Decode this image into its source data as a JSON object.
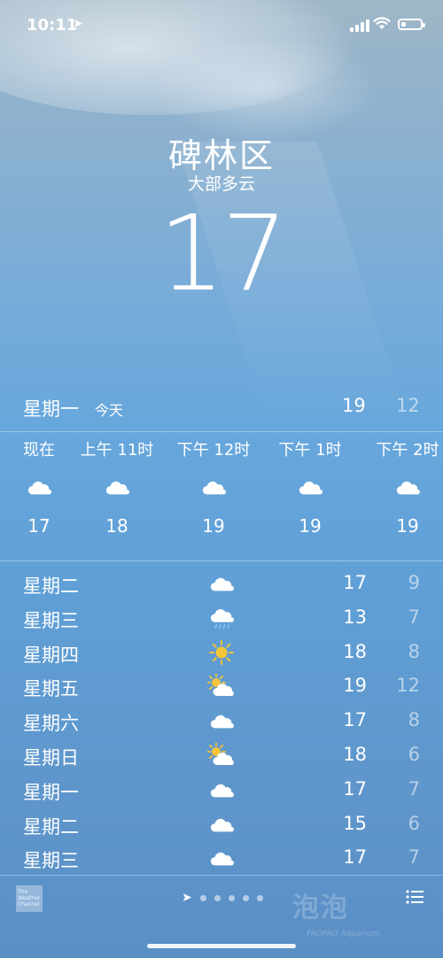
{
  "status_bar": {
    "time": "10:11"
  },
  "header": {
    "city": "碑林区",
    "condition": "大部多云",
    "temperature": "17"
  },
  "today": {
    "day": "星期一",
    "label": "今天",
    "high": "19",
    "low": "12"
  },
  "hourly": [
    {
      "time": "现在",
      "icon": "cloud",
      "temp": "17"
    },
    {
      "time": "上午 11时",
      "icon": "cloud",
      "temp": "18"
    },
    {
      "time": "下午 12时",
      "icon": "cloud",
      "temp": "19"
    },
    {
      "time": "下午 1时",
      "icon": "cloud",
      "temp": "19"
    },
    {
      "time": "下午 2时",
      "icon": "cloud",
      "temp": "19"
    }
  ],
  "daily": [
    {
      "day": "星期二",
      "icon": "cloud",
      "high": "17",
      "low": "9"
    },
    {
      "day": "星期三",
      "icon": "rain",
      "high": "13",
      "low": "7"
    },
    {
      "day": "星期四",
      "icon": "sun",
      "high": "18",
      "low": "8"
    },
    {
      "day": "星期五",
      "icon": "partly-sunny",
      "high": "19",
      "low": "12"
    },
    {
      "day": "星期六",
      "icon": "cloud",
      "high": "17",
      "low": "8"
    },
    {
      "day": "星期日",
      "icon": "partly-sunny",
      "high": "18",
      "low": "6"
    },
    {
      "day": "星期一",
      "icon": "cloud",
      "high": "17",
      "low": "7"
    },
    {
      "day": "星期二",
      "icon": "cloud",
      "high": "15",
      "low": "6"
    },
    {
      "day": "星期三",
      "icon": "cloud",
      "high": "17",
      "low": "7"
    }
  ],
  "footer": {
    "logo_text": "The Weather Channel",
    "watermark": "泡泡",
    "watermark_sub": "PAOPAO Aquarium",
    "pages": 6,
    "active_page": 0
  },
  "colors": {
    "sun": "#f5c53a",
    "cloud": "#ffffff",
    "rain": "#7ec8ff"
  }
}
